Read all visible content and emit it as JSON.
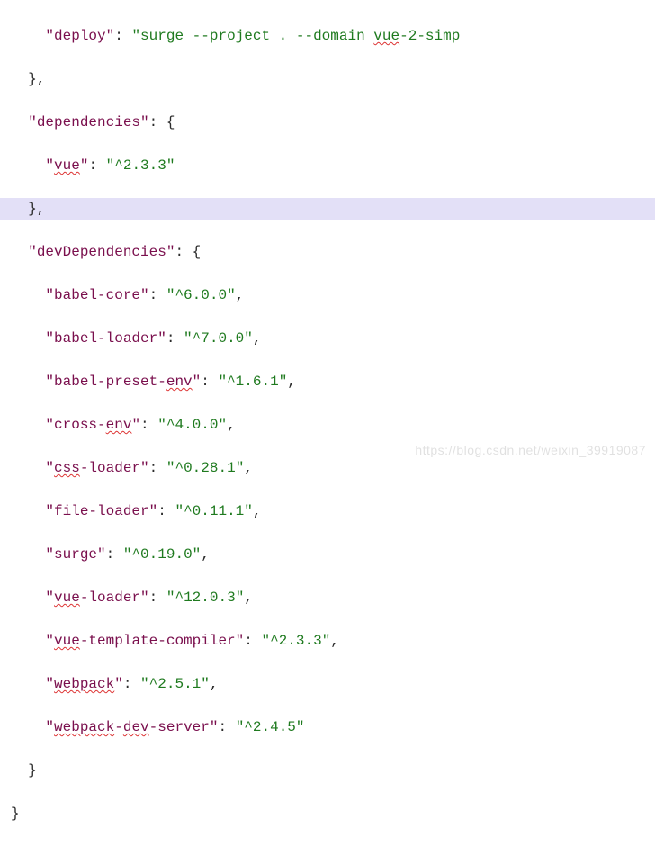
{
  "scripts": {
    "deploy_key": "deploy",
    "deploy_value_prefix": "surge --project . --domain ",
    "deploy_value_typo": "vue",
    "deploy_value_suffix": "-2-simp"
  },
  "dependencies_label": "dependencies",
  "dependencies": {
    "vue_key": "vue",
    "vue_value": "^2.3.3"
  },
  "devDependencies_label": "devDependencies",
  "devDependencies": {
    "babel_core_key": "babel-core",
    "babel_core_value": "^6.0.0",
    "babel_loader_key": "babel-loader",
    "babel_loader_value": "^7.0.0",
    "babel_preset_env_key_prefix": "babel-preset-",
    "babel_preset_env_key_typo": "env",
    "babel_preset_env_value": "^1.6.1",
    "cross_env_key_prefix": "cross-",
    "cross_env_key_typo": "env",
    "cross_env_value": "^4.0.0",
    "css_loader_key_typo": "css",
    "css_loader_key_suffix": "-loader",
    "css_loader_value": "^0.28.1",
    "file_loader_key": "file-loader",
    "file_loader_value": "^0.11.1",
    "surge_key": "surge",
    "surge_value": "^0.19.0",
    "vue_loader_key_typo": "vue",
    "vue_loader_key_suffix": "-loader",
    "vue_loader_value": "^12.0.3",
    "vue_template_compiler_key_typo": "vue",
    "vue_template_compiler_key_suffix": "-template-compiler",
    "vue_template_compiler_value": "^2.3.3",
    "webpack_key_typo": "webpack",
    "webpack_value": "^2.5.1",
    "webpack_dev_server_key_typo1": "webpack",
    "webpack_dev_server_key_mid": "-",
    "webpack_dev_server_key_typo2": "dev",
    "webpack_dev_server_key_suffix": "-server",
    "webpack_dev_server_value": "^2.4.5"
  },
  "watermark": "https://blog.csdn.net/weixin_39919087"
}
